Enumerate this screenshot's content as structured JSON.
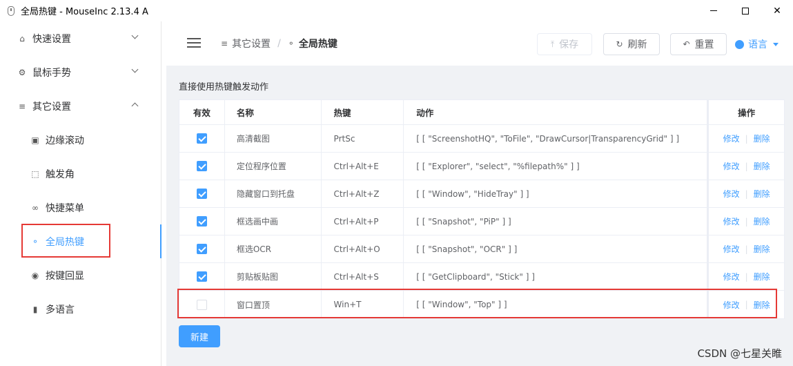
{
  "window": {
    "title": "全局热键 - MouseInc 2.13.4 A",
    "controls": {
      "minimize": "—",
      "maximize": "☐",
      "close": "✕"
    }
  },
  "sidebar": {
    "items": [
      {
        "label": "快速设置",
        "icon": "home-icon",
        "level": "top",
        "expanded": false
      },
      {
        "label": "鼠标手势",
        "icon": "gear-icon",
        "level": "top",
        "expanded": false
      },
      {
        "label": "其它设置",
        "icon": "sliders-icon",
        "level": "top",
        "expanded": true
      },
      {
        "label": "边缘滚动",
        "icon": "monitor-icon",
        "level": "sub"
      },
      {
        "label": "触发角",
        "icon": "corners-icon",
        "level": "sub"
      },
      {
        "label": "快捷菜单",
        "icon": "link-icon",
        "level": "sub"
      },
      {
        "label": "全局热键",
        "icon": "key-icon",
        "level": "sub",
        "active": true
      },
      {
        "label": "按键回显",
        "icon": "eye-icon",
        "level": "sub"
      },
      {
        "label": "多语言",
        "icon": "microphone-icon",
        "level": "sub"
      }
    ]
  },
  "header": {
    "breadcrumb": [
      {
        "label": "其它设置",
        "icon": "sliders-icon"
      },
      {
        "label": "全局热键",
        "icon": "key-icon"
      }
    ],
    "breadcrumb_sep": "/",
    "buttons": {
      "save": "保存",
      "refresh": "刷新",
      "reset": "重置"
    },
    "language": "语言"
  },
  "main": {
    "section_label": "直接使用热键触发动作",
    "columns": [
      "有效",
      "名称",
      "热键",
      "动作",
      "操作"
    ],
    "rows": [
      {
        "enabled": true,
        "name": "高清截图",
        "hotkey": "PrtSc",
        "action": "[ [ \"ScreenshotHQ\", \"ToFile\", \"DrawCursor|TransparencyGrid\" ] ]",
        "edit": "修改",
        "delete": "删除"
      },
      {
        "enabled": true,
        "name": "定位程序位置",
        "hotkey": "Ctrl+Alt+E",
        "action": "[ [ \"Explorer\", \"select\", \"%filepath%\" ] ]",
        "edit": "修改",
        "delete": "删除"
      },
      {
        "enabled": true,
        "name": "隐藏窗口到托盘",
        "hotkey": "Ctrl+Alt+Z",
        "action": "[ [ \"Window\", \"HideTray\" ] ]",
        "edit": "修改",
        "delete": "删除"
      },
      {
        "enabled": true,
        "name": "框选画中画",
        "hotkey": "Ctrl+Alt+P",
        "action": "[ [ \"Snapshot\", \"PiP\" ] ]",
        "edit": "修改",
        "delete": "删除"
      },
      {
        "enabled": true,
        "name": "框选OCR",
        "hotkey": "Ctrl+Alt+O",
        "action": "[ [ \"Snapshot\", \"OCR\" ] ]",
        "edit": "修改",
        "delete": "删除"
      },
      {
        "enabled": true,
        "name": "剪贴板贴图",
        "hotkey": "Ctrl+Alt+S",
        "action": "[ [ \"GetClipboard\", \"Stick\" ] ]",
        "edit": "修改",
        "delete": "删除"
      },
      {
        "enabled": false,
        "name": "窗口置顶",
        "hotkey": "Win+T",
        "action": "[ [ \"Window\", \"Top\" ] ]",
        "edit": "修改",
        "delete": "删除"
      }
    ],
    "new_button": "新建"
  },
  "watermark": "CSDN @七星关睢",
  "colors": {
    "accent": "#409eff",
    "highlight_box": "#e53935"
  }
}
